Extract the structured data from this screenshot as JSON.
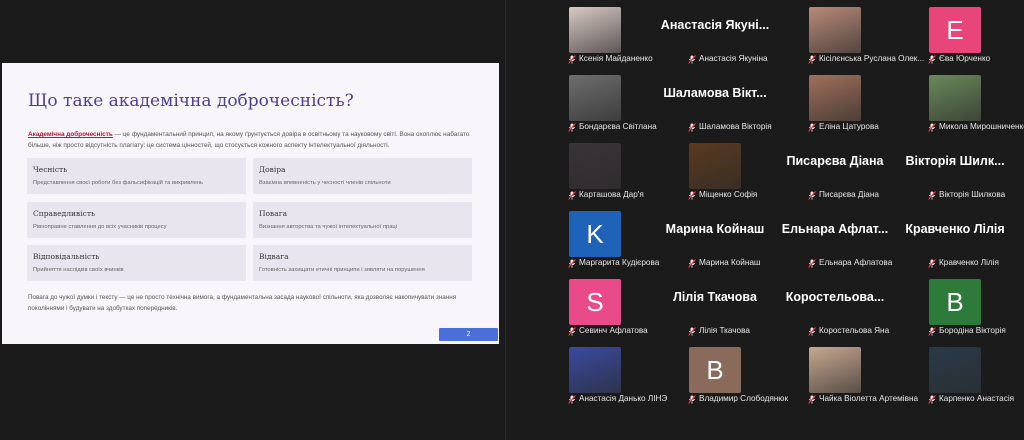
{
  "slide": {
    "title": "Що таке академічна доброчесність?",
    "intro_term": "Академічна доброчесність",
    "intro_rest": " — це фундаментальний принцип, на якому ґрунтується довіра в освітньому та науковому світі. Вона охоплює набагато більше, ніж просто відсутність плагіату: це система цінностей, що стосується кожного аспекту інтелектуальної діяльності.",
    "cards": [
      {
        "title": "Чесність",
        "desc": "Представлення своєї роботи без фальсифікацій та викривлень"
      },
      {
        "title": "Довіра",
        "desc": "Взаємна впевненість у чесності членів спільноти"
      },
      {
        "title": "Справедливість",
        "desc": "Рівноправне ставлення до всіх учасників процесу"
      },
      {
        "title": "Повага",
        "desc": "Визнання авторства та чужої інтелектуальної праці"
      },
      {
        "title": "Відповідальність",
        "desc": "Прийняття наслідків своїх вчинків"
      },
      {
        "title": "Відвага",
        "desc": "Готовність захищати етичні принципи і зявляти на порушення"
      }
    ],
    "footer": "Повага до чужої думки і тексту — це не просто технічна вимога, а фундаментальна засада наукової спільноти, яка дозволяє накопичувати знання поколіннями і будувати на здобутках попередників.",
    "page": "2"
  },
  "participants": [
    {
      "name": "Ксенія Майданенко",
      "avatar": "photo",
      "color": "#d9c9c4"
    },
    {
      "name": "Анастасія Якуніна",
      "bigname": "Анастасія Якуні...",
      "avatar": "none"
    },
    {
      "name": "Кісілєнська Руслана Олек...",
      "avatar": "photo",
      "color": "#b88a78"
    },
    {
      "name": "Єва Юрченко",
      "avatar": "letter",
      "letter": "E",
      "color": "#e8457a"
    },
    {
      "name": "Бондарєва Світлана",
      "avatar": "photo",
      "color": "#6e6e6e"
    },
    {
      "name": "Шаламова Вікторія",
      "bigname": "Шаламова Вікт...",
      "avatar": "none"
    },
    {
      "name": "Еліна Цатурова",
      "avatar": "photo",
      "color": "#a0705a"
    },
    {
      "name": "Микола Мирошниченко",
      "avatar": "photo",
      "color": "#6a8a5a"
    },
    {
      "name": "Карташова Дар'я",
      "avatar": "photo",
      "color": "#3a3338"
    },
    {
      "name": "Міщенко Софія",
      "avatar": "photo",
      "color": "#5a3a1e"
    },
    {
      "name": "Писарєва Діана",
      "bigname": "Писарєва Діана",
      "avatar": "none"
    },
    {
      "name": "Вікторія Шилкова",
      "bigname": "Вікторія Шилк...",
      "avatar": "none"
    },
    {
      "name": "Маргарита Кудієрова",
      "avatar": "letter",
      "letter": "K",
      "color": "#1e63b8"
    },
    {
      "name": "Марина Койнаш",
      "bigname": "Марина Койнаш",
      "avatar": "none"
    },
    {
      "name": "Ельнара Афлатова",
      "bigname": "Ельнара Афлат...",
      "avatar": "none"
    },
    {
      "name": "Кравченко Лілія",
      "bigname": "Кравченко Лілія",
      "avatar": "none"
    },
    {
      "name": "Севинч Афлатова",
      "avatar": "letter",
      "letter": "S",
      "color": "#e84a8a"
    },
    {
      "name": "Лілія Ткачова",
      "bigname": "Лілія Ткачова",
      "avatar": "none"
    },
    {
      "name": "Коростельова Яна",
      "bigname": "Коростельова...",
      "avatar": "none"
    },
    {
      "name": "Бородіна Вікторія",
      "avatar": "letter",
      "letter": "B",
      "color": "#2e7a3a"
    },
    {
      "name": "Анастасія Данько ЛІНЭ",
      "avatar": "photo",
      "color": "#3a4aa0"
    },
    {
      "name": "Владимир Слободянюк",
      "avatar": "letter",
      "letter": "B",
      "color": "#8a6a5a"
    },
    {
      "name": "Чайка Віолетта Артемівна",
      "avatar": "photo",
      "color": "#c8a890"
    },
    {
      "name": "Карпенко Анастасія",
      "avatar": "photo",
      "color": "#2a3a4a"
    }
  ]
}
